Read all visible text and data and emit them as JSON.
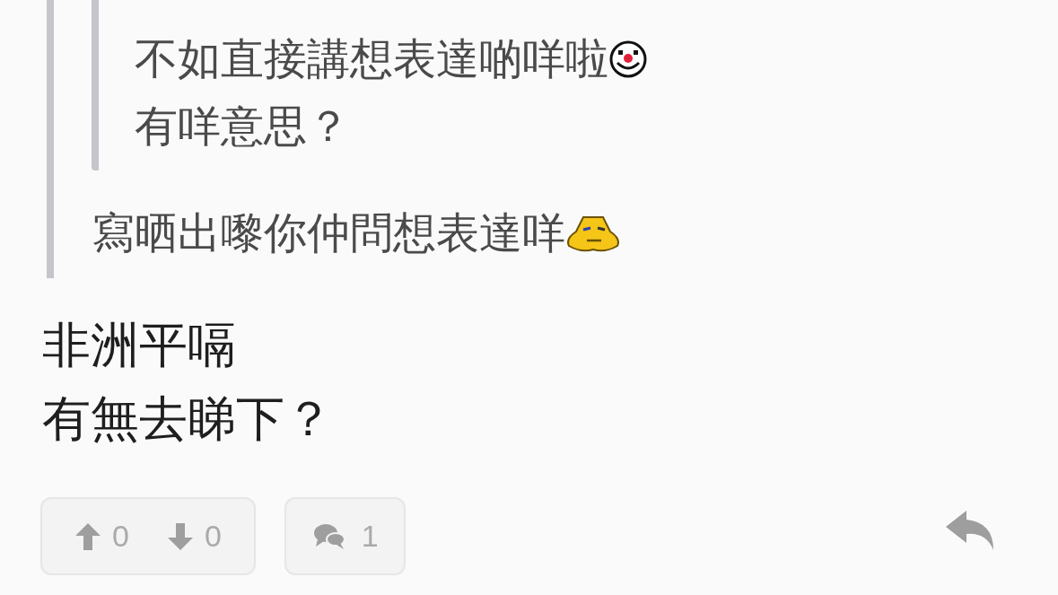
{
  "quote": {
    "quote": {
      "lines": [
        {
          "text": "不如直接講想表達啲咩啦",
          "kind": "clown"
        },
        {
          "text": "有咩意思？",
          "kind": "plain"
        }
      ]
    },
    "lines": [
      {
        "text": "寫晒出嚟你仲問想表達咩",
        "kind": "blob"
      }
    ]
  },
  "body": {
    "lines": [
      "非洲平嗝",
      "有無去睇下？"
    ]
  },
  "actions": {
    "upvotes": "0",
    "downvotes": "0",
    "replies": "1"
  }
}
